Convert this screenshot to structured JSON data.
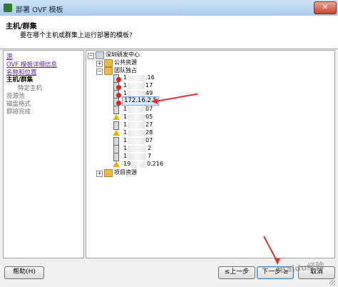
{
  "window": {
    "title": "部署 OVF 模板",
    "close_label": "✕"
  },
  "header": {
    "title": "主机/群集",
    "subtitle": "要在哪个主机或群集上运行部署的模板?"
  },
  "steps": [
    {
      "label": "源",
      "state": "link"
    },
    {
      "label": "OVF 模板详细信息",
      "state": "link"
    },
    {
      "label": "名称和位置",
      "state": "link"
    },
    {
      "label": "主机/群集",
      "state": "current"
    },
    {
      "label": "特定主机",
      "state": "pending-sub"
    },
    {
      "label": "资源池",
      "state": "pending"
    },
    {
      "label": "磁盘格式",
      "state": "pending"
    },
    {
      "label": "即将完成",
      "state": "pending"
    }
  ],
  "tree": {
    "datacenter": "深圳研发中心",
    "folder_public": "公共资源",
    "folder_team": "团队独占",
    "hosts": [
      {
        "suffix": ".16",
        "status": "error"
      },
      {
        "suffix": "17",
        "status": "error"
      },
      {
        "suffix": "49",
        "status": "error"
      },
      {
        "label": "172.16.2.5",
        "status": "error",
        "selected": true
      },
      {
        "suffix": "07",
        "status": "normal"
      },
      {
        "suffix": "05",
        "status": "warning"
      },
      {
        "suffix": "27",
        "status": "normal"
      },
      {
        "suffix": "28",
        "status": "warning"
      },
      {
        "suffix": "07",
        "status": "normal"
      },
      {
        "suffix": "2",
        "status": "normal"
      },
      {
        "suffix": "7",
        "status": "normal"
      },
      {
        "suffix": "0.216",
        "status": "warning",
        "prefix": "19"
      }
    ],
    "folder_project": "项目资源",
    "host_prefix": "1",
    "expand_minus": "−",
    "expand_plus": "+"
  },
  "buttons": {
    "help": "帮助(H)",
    "back": "≤上一步",
    "next": "下一步 ≥",
    "cancel": "取消"
  },
  "watermark": "Baidu经验"
}
